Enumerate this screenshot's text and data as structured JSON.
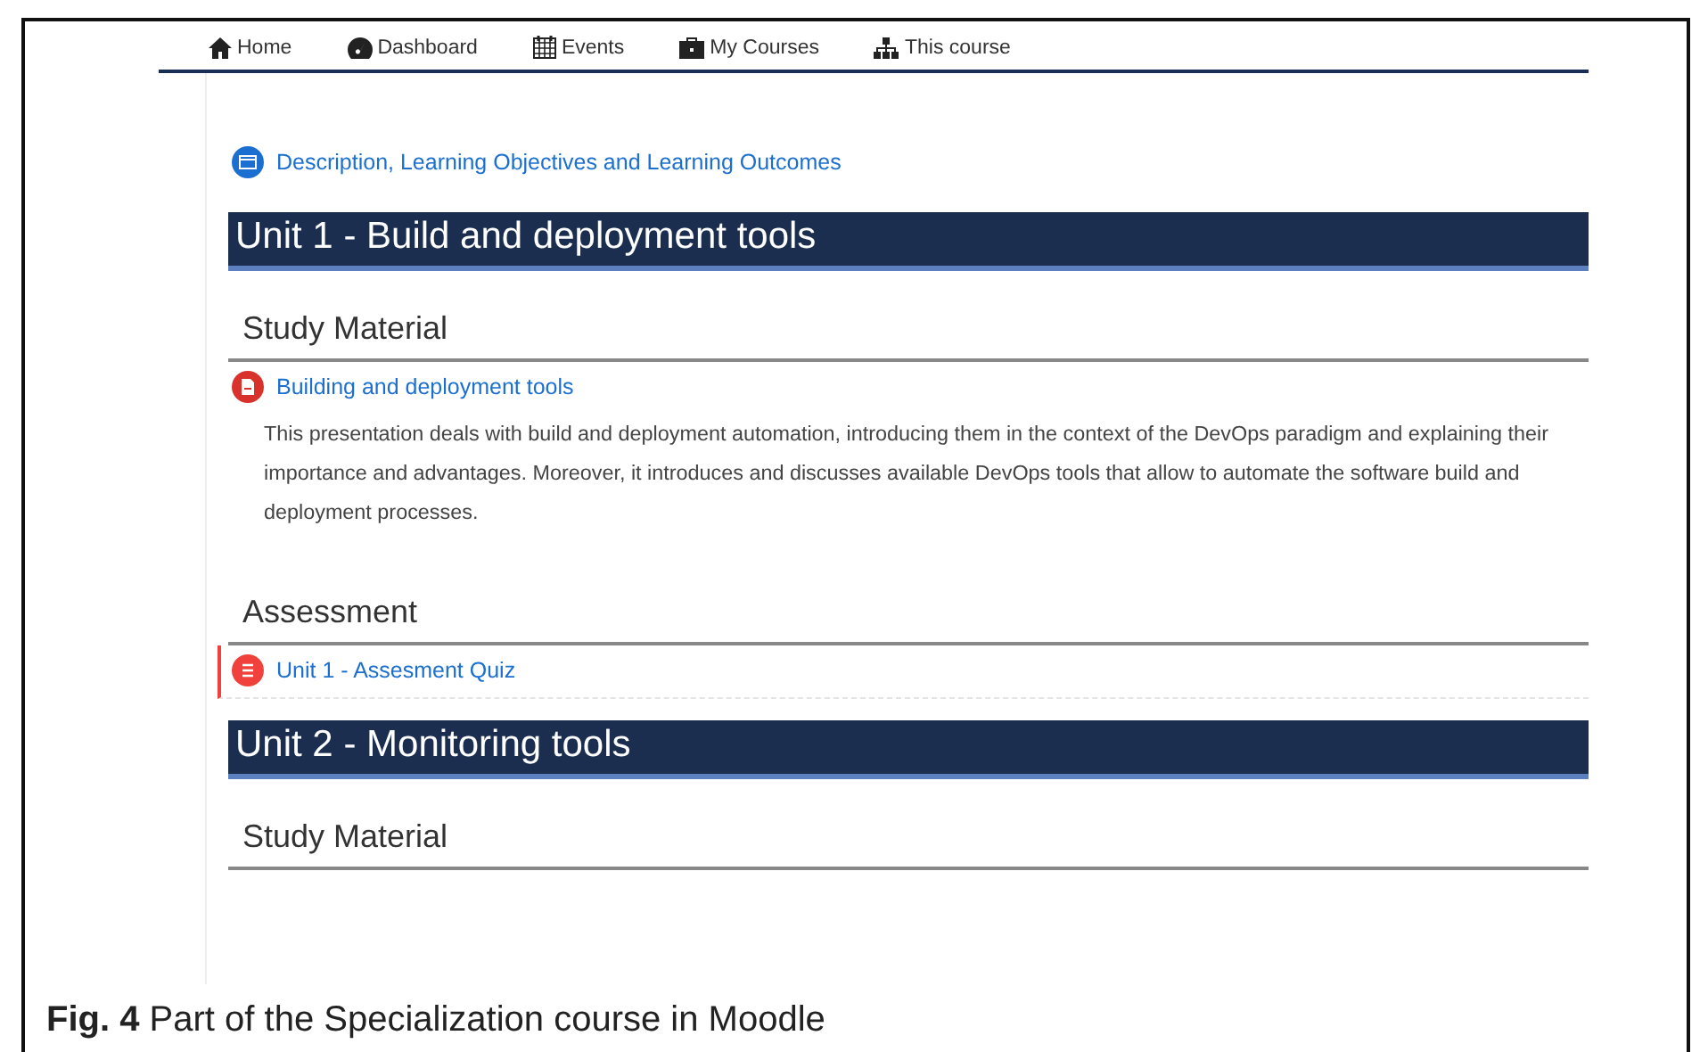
{
  "nav": [
    {
      "label": "Home"
    },
    {
      "label": "Dashboard"
    },
    {
      "label": "Events"
    },
    {
      "label": "My Courses"
    },
    {
      "label": "This course"
    }
  ],
  "content": [
    {
      "kind": "link",
      "label": "Description, Learning Objectives and Learning Outcomes",
      "color": "#1b6fd1",
      "highlighted": false
    },
    {
      "kind": "unit",
      "label": "Unit 1 - Build and deployment tools"
    },
    {
      "kind": "section",
      "label": "Study Material"
    },
    {
      "kind": "link",
      "label": "Building and deployment tools",
      "color": "#d9312b",
      "highlighted": false
    },
    {
      "kind": "description",
      "text": "This presentation deals with build and deployment automation, introducing them in the context of the DevOps paradigm and explaining their importance and advantages. Moreover, it introduces and discusses available DevOps tools that allow to automate the software build and deployment processes."
    },
    {
      "kind": "section",
      "label": "Assessment"
    },
    {
      "kind": "link",
      "label": "Unit 1 - Assesment Quiz",
      "color": "#f0413c",
      "highlighted": true
    },
    {
      "kind": "unit",
      "label": "Unit 2 - Monitoring tools"
    },
    {
      "kind": "section",
      "label": "Study Material"
    }
  ],
  "caption": "**Fig. 4** Part of the Specialization course in Moodle"
}
